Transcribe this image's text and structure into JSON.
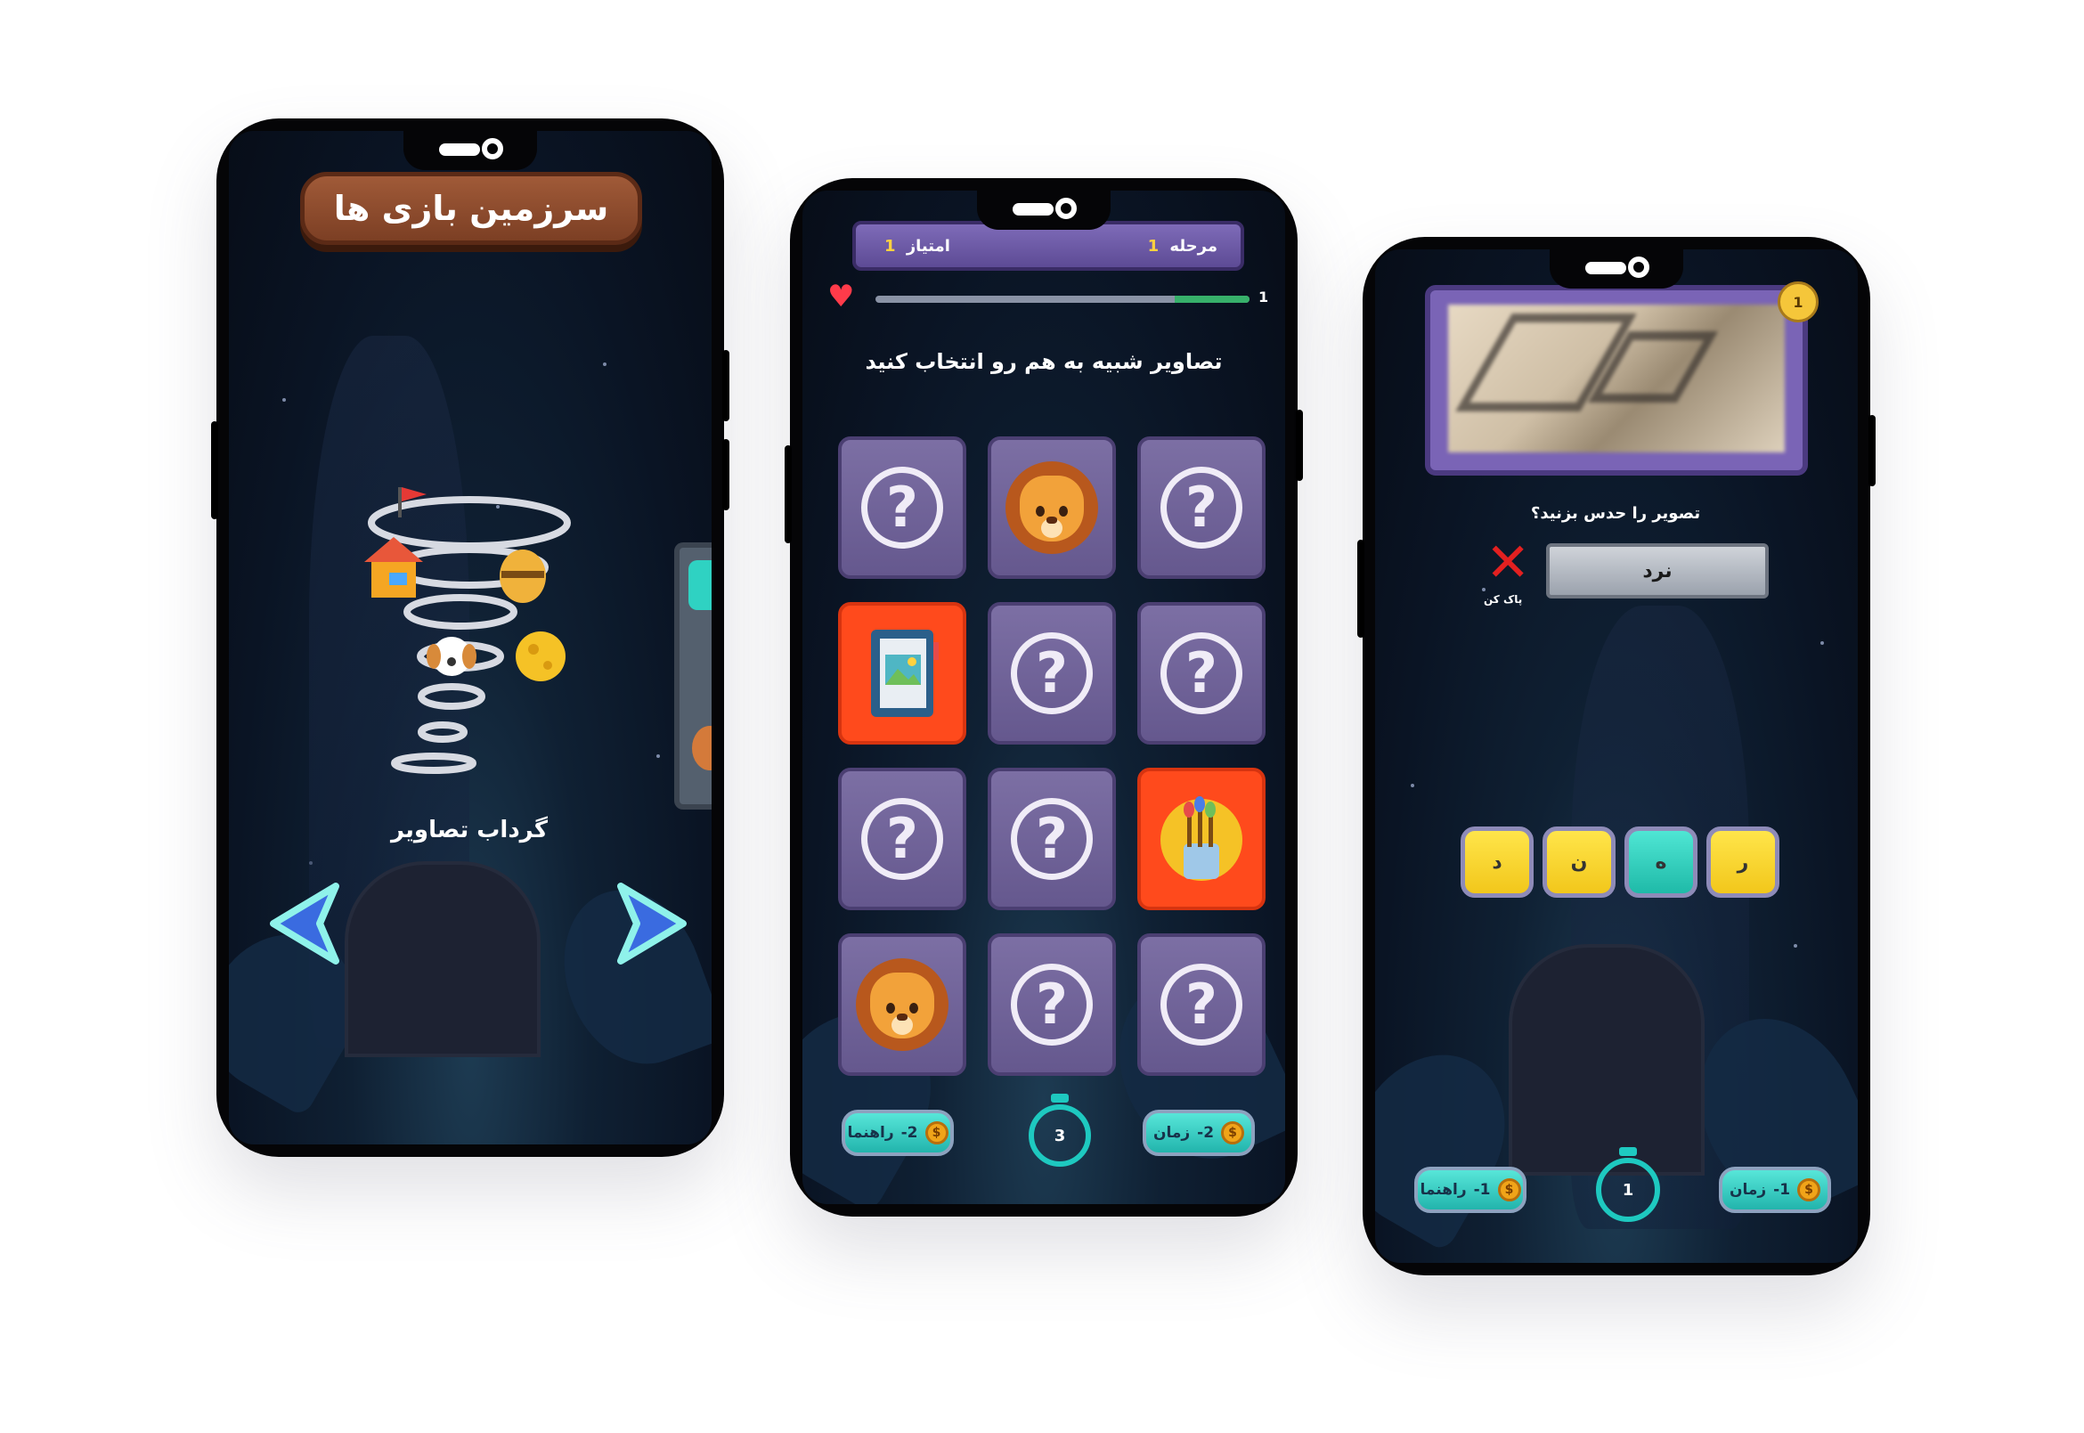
{
  "phone1": {
    "title": "سرزمین بازی ها",
    "game_name": "گرداب تصاویر",
    "prev_label": "◀",
    "next_label": "▶"
  },
  "phone2": {
    "stage_label": "مرحله",
    "stage_value": "1",
    "score_label": "امتیاز",
    "score_value": "1",
    "lives": "1",
    "progress": 0.2,
    "instruction": "تصاویر شبیه به هم رو انتخاب کنید",
    "cards": [
      {
        "state": "hidden"
      },
      {
        "state": "lion"
      },
      {
        "state": "hidden"
      },
      {
        "state": "album"
      },
      {
        "state": "hidden"
      },
      {
        "state": "hidden"
      },
      {
        "state": "hidden"
      },
      {
        "state": "hidden"
      },
      {
        "state": "brushes"
      },
      {
        "state": "lion"
      },
      {
        "state": "hidden"
      },
      {
        "state": "hidden"
      }
    ],
    "hint_label": "راهنما",
    "hint_cost": "-2",
    "time_label": "زمان",
    "time_cost": "-2",
    "timer": "3"
  },
  "phone3": {
    "level": "1",
    "question": "تصویر را حدس بزنید؟",
    "answer": "نرد",
    "clear_label": "پاک کن",
    "letters": [
      "د",
      "ن",
      "ه",
      "ر"
    ],
    "hint_label": "راهنما",
    "hint_cost": "-1",
    "time_label": "زمان",
    "time_cost": "-1",
    "timer": "1"
  },
  "colors": {
    "accent_teal": "#1ec9c0",
    "card_purple": "#6f629a",
    "card_red": "#ff4a1c",
    "letter_yellow": "#f5d22a"
  }
}
